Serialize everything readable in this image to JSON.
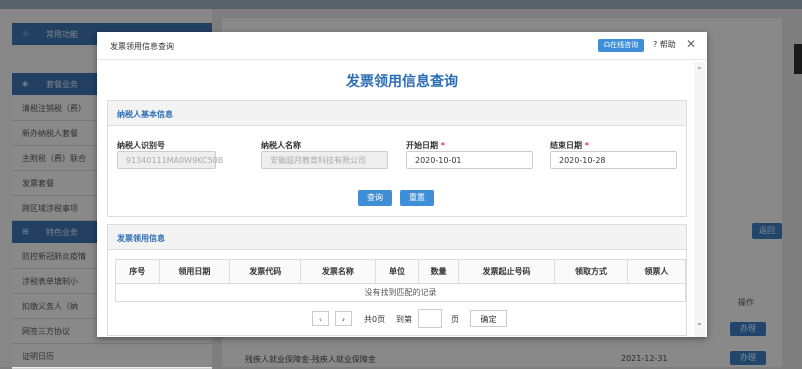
{
  "background": {
    "sidebar": {
      "sections": [
        {
          "icon": "star-icon",
          "label": "常用功能"
        },
        {
          "icon": "package-icon",
          "label": "套餐业务"
        },
        {
          "icon": "grid-icon",
          "label": "特色业务"
        }
      ],
      "package_items": [
        "清税注销税（费）",
        "新办纳税人套餐",
        "主附税（费）联合",
        "发票套餐",
        "跨区域涉税事项"
      ],
      "feature_items": [
        "防控新冠肺炎疫情",
        "涉税表单填制小",
        "扣缴义务人（纳",
        "网签三方协议",
        "证明日历"
      ]
    },
    "main": {
      "return_button": "返回",
      "operation_header": "操作",
      "handle_button": "办理",
      "last_row_name": "残疾人就业保障金-残疾人就业保障金",
      "last_row_date": "2021-12-31"
    }
  },
  "modal": {
    "title": "发票领用信息查询",
    "online_service_button": "在线咨询",
    "help_label": "帮助",
    "page_title": "发票领用信息查询",
    "taxpayer_panel": {
      "heading": "纳税人基本信息",
      "fields": {
        "tax_id": {
          "label": "纳税人识别号",
          "value": "91340111MA0W9KC50B"
        },
        "name": {
          "label": "纳税人名称",
          "value": "安徽超月教育科技有限公司"
        },
        "start_date": {
          "label": "开始日期",
          "required_mark": "*",
          "value": "2020-10-01"
        },
        "end_date": {
          "label": "结束日期",
          "required_mark": "*",
          "value": "2020-10-28"
        }
      },
      "query_button": "查询",
      "reset_button": "重置"
    },
    "invoice_panel": {
      "heading": "发票领用信息",
      "columns": [
        "序号",
        "领用日期",
        "发票代码",
        "发票名称",
        "单位",
        "数量",
        "发票起止号码",
        "领取方式",
        "领票人"
      ],
      "empty_message": "没有找到匹配的记录"
    },
    "pager": {
      "prev": "‹",
      "next": "›",
      "total_pages": "共0页",
      "goto_label": "到第",
      "page_input": "",
      "page_unit": "页",
      "confirm_button": "确定"
    }
  }
}
